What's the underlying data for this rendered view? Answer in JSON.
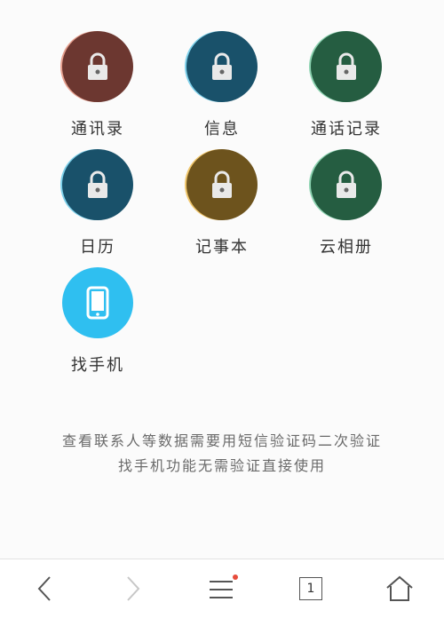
{
  "apps": [
    {
      "label": "通讯录",
      "icon": "padlock-icon",
      "color": "#7c3f37"
    },
    {
      "label": "信息",
      "icon": "padlock-icon",
      "color": "#1d5d79"
    },
    {
      "label": "通话记录",
      "icon": "padlock-icon",
      "color": "#2b6a4b"
    },
    {
      "label": "日历",
      "icon": "padlock-icon",
      "color": "#1d5d79"
    },
    {
      "label": "记事本",
      "icon": "padlock-icon",
      "color": "#7d5f22"
    },
    {
      "label": "云相册",
      "icon": "padlock-icon",
      "color": "#2b6a4b"
    },
    {
      "label": "找手机",
      "icon": "phone-icon",
      "color": "#2fbff0"
    }
  ],
  "info": {
    "line1": "查看联系人等数据需要用短信验证码二次验证",
    "line2": "找手机功能无需验证直接使用"
  },
  "bottom_bar": {
    "tabs_count": "1",
    "icons": [
      "back-icon",
      "forward-icon",
      "menu-icon",
      "tabs-icon",
      "home-icon"
    ],
    "accent": "#e74c3c"
  }
}
